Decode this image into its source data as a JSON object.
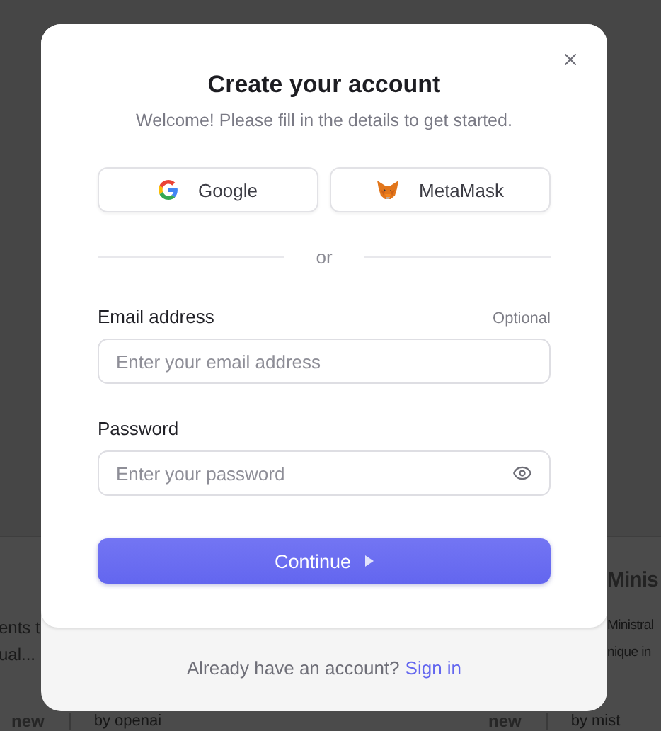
{
  "background": {
    "left_lines": [
      "ents t",
      "ual..."
    ],
    "right_card": {
      "title": "Minis",
      "lines": [
        "Ministral",
        "nique in"
      ]
    },
    "footers": [
      {
        "badge": "new",
        "author": "by openai"
      },
      {
        "badge": "new",
        "author": "by mist"
      }
    ]
  },
  "dialog": {
    "title": "Create your account",
    "subtitle": "Welcome! Please fill in the details to get started.",
    "social_buttons": [
      {
        "kind": "google",
        "label": "Google"
      },
      {
        "kind": "metamask",
        "label": "MetaMask"
      }
    ],
    "divider": "or",
    "fields": [
      {
        "kind": "email",
        "label": "Email address",
        "hint": "Optional",
        "placeholder": "Enter your email address"
      },
      {
        "kind": "password",
        "label": "Password",
        "placeholder": "Enter your password"
      }
    ],
    "submit": "Continue",
    "footer": {
      "text": "Already have an account?",
      "link": "Sign in"
    }
  }
}
